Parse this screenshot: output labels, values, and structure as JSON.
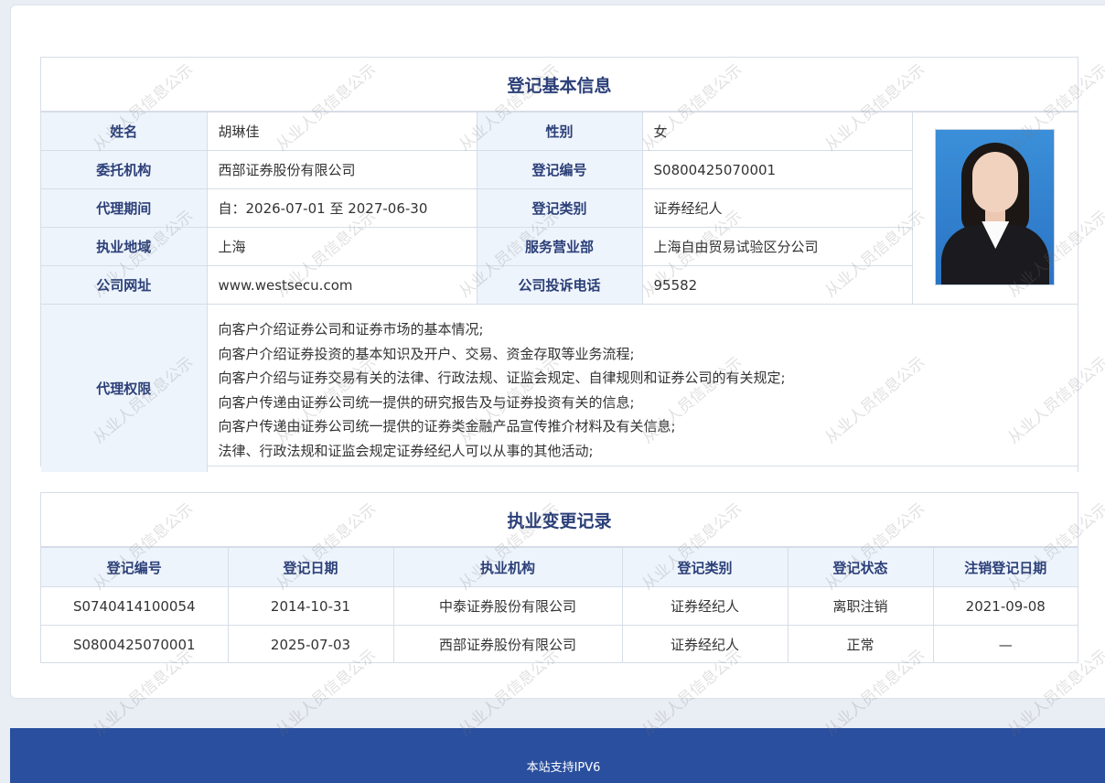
{
  "basic_info": {
    "title": "登记基本信息",
    "rows": [
      [
        {
          "label": "姓名",
          "value": "胡琳佳"
        },
        {
          "label": "性别",
          "value": "女"
        }
      ],
      [
        {
          "label": "委托机构",
          "value": "西部证券股份有限公司"
        },
        {
          "label": "登记编号",
          "value": "S0800425070001"
        }
      ],
      [
        {
          "label": "代理期间",
          "value": "自：2026-07-01 至 2027-06-30"
        },
        {
          "label": "登记类别",
          "value": "证券经纪人"
        }
      ],
      [
        {
          "label": "执业地域",
          "value": "上海"
        },
        {
          "label": "服务营业部",
          "value": "上海自由贸易试验区分公司"
        }
      ],
      [
        {
          "label": "公司网址",
          "value": "www.westsecu.com"
        },
        {
          "label": "公司投诉电话",
          "value": "95582"
        }
      ]
    ],
    "scope_label": "代理权限",
    "scope_lines": [
      "向客户介绍证券公司和证券市场的基本情况;",
      "向客户介绍证券投资的基本知识及开户、交易、资金存取等业务流程;",
      "向客户介绍与证券交易有关的法律、行政法规、证监会规定、自律规则和证券公司的有关规定;",
      "向客户传递由证券公司统一提供的研究报告及与证券投资有关的信息;",
      "向客户传递由证券公司统一提供的证券类金融产品宣传推介材料及有关信息;",
      "法律、行政法规和证监会规定证券经纪人可以从事的其他活动;"
    ]
  },
  "records": {
    "title": "执业变更记录",
    "headers": [
      "登记编号",
      "登记日期",
      "执业机构",
      "登记类别",
      "登记状态",
      "注销登记日期"
    ],
    "rows": [
      [
        "S0740414100054",
        "2014-10-31",
        "中泰证券股份有限公司",
        "证券经纪人",
        "离职注销",
        "2021-09-08"
      ],
      [
        "S0800425070001",
        "2025-07-03",
        "西部证券股份有限公司",
        "证券经纪人",
        "正常",
        "—"
      ]
    ]
  },
  "watermark": "从业人员信息公示",
  "footer": {
    "text": "本站支持IPV6"
  },
  "colors": {
    "label_bg": "#eef4fc",
    "title": "#2b3f78",
    "footer_bg": "#2a4f9e",
    "page_bg": "#e9edf4"
  }
}
